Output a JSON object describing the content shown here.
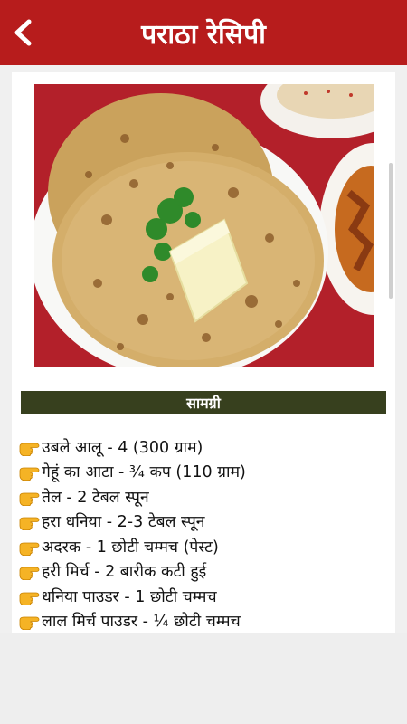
{
  "appbar": {
    "title": "पराठा रेसिपी",
    "back_icon": "chevron-left-icon",
    "color": "#b71c1c"
  },
  "section": {
    "title": "सामग्री",
    "color": "#37401e"
  },
  "ingredient_icon": "pointing-hand-icon",
  "ingredients": [
    "उबले आलू - 4 (300 ग्राम)",
    "गेहूं का आटा - ¾ कप (110 ग्राम)",
    "तेल - 2 टेबल स्पून",
    "हरा धनिया - 2-3 टेबल स्पून",
    "अदरक - 1 छोटी चम्मच (पेस्ट)",
    "हरी मिर्च - 2 बारीक कटी हुई",
    "धनिया पाउडर - 1 छोटी चम्मच",
    "लाल मिर्च पाउडर - ¼ छोटी चम्मच"
  ]
}
